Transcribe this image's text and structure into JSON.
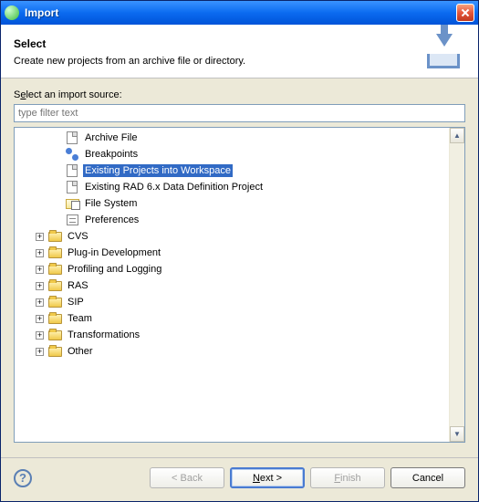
{
  "titlebar": {
    "title": "Import"
  },
  "header": {
    "title": "Select",
    "description": "Create new projects from an archive file or directory."
  },
  "filter": {
    "label_pre": "S",
    "label_u": "e",
    "label_post": "lect an import source:",
    "placeholder": "type filter text"
  },
  "tree": {
    "items": [
      {
        "label": "Archive File",
        "icon": "doc",
        "depth": 2,
        "expander": false,
        "selected": false
      },
      {
        "label": "Breakpoints",
        "icon": "bp",
        "depth": 2,
        "expander": false,
        "selected": false
      },
      {
        "label": "Existing Projects into Workspace",
        "icon": "doc",
        "depth": 2,
        "expander": false,
        "selected": true
      },
      {
        "label": "Existing RAD 6.x Data Definition Project",
        "icon": "doc",
        "depth": 2,
        "expander": false,
        "selected": false
      },
      {
        "label": "File System",
        "icon": "fs",
        "depth": 2,
        "expander": false,
        "selected": false
      },
      {
        "label": "Preferences",
        "icon": "pref",
        "depth": 2,
        "expander": false,
        "selected": false
      },
      {
        "label": "CVS",
        "icon": "folder",
        "depth": 1,
        "expander": true,
        "selected": false
      },
      {
        "label": "Plug-in Development",
        "icon": "folder",
        "depth": 1,
        "expander": true,
        "selected": false
      },
      {
        "label": "Profiling and Logging",
        "icon": "folder",
        "depth": 1,
        "expander": true,
        "selected": false
      },
      {
        "label": "RAS",
        "icon": "folder",
        "depth": 1,
        "expander": true,
        "selected": false
      },
      {
        "label": "SIP",
        "icon": "folder",
        "depth": 1,
        "expander": true,
        "selected": false
      },
      {
        "label": "Team",
        "icon": "folder",
        "depth": 1,
        "expander": true,
        "selected": false
      },
      {
        "label": "Transformations",
        "icon": "folder",
        "depth": 1,
        "expander": true,
        "selected": false
      },
      {
        "label": "Other",
        "icon": "folder",
        "depth": 1,
        "expander": true,
        "selected": false
      }
    ]
  },
  "buttons": {
    "back": "< Back",
    "next": "Next >",
    "finish": "Finish",
    "cancel": "Cancel",
    "help": "?"
  }
}
